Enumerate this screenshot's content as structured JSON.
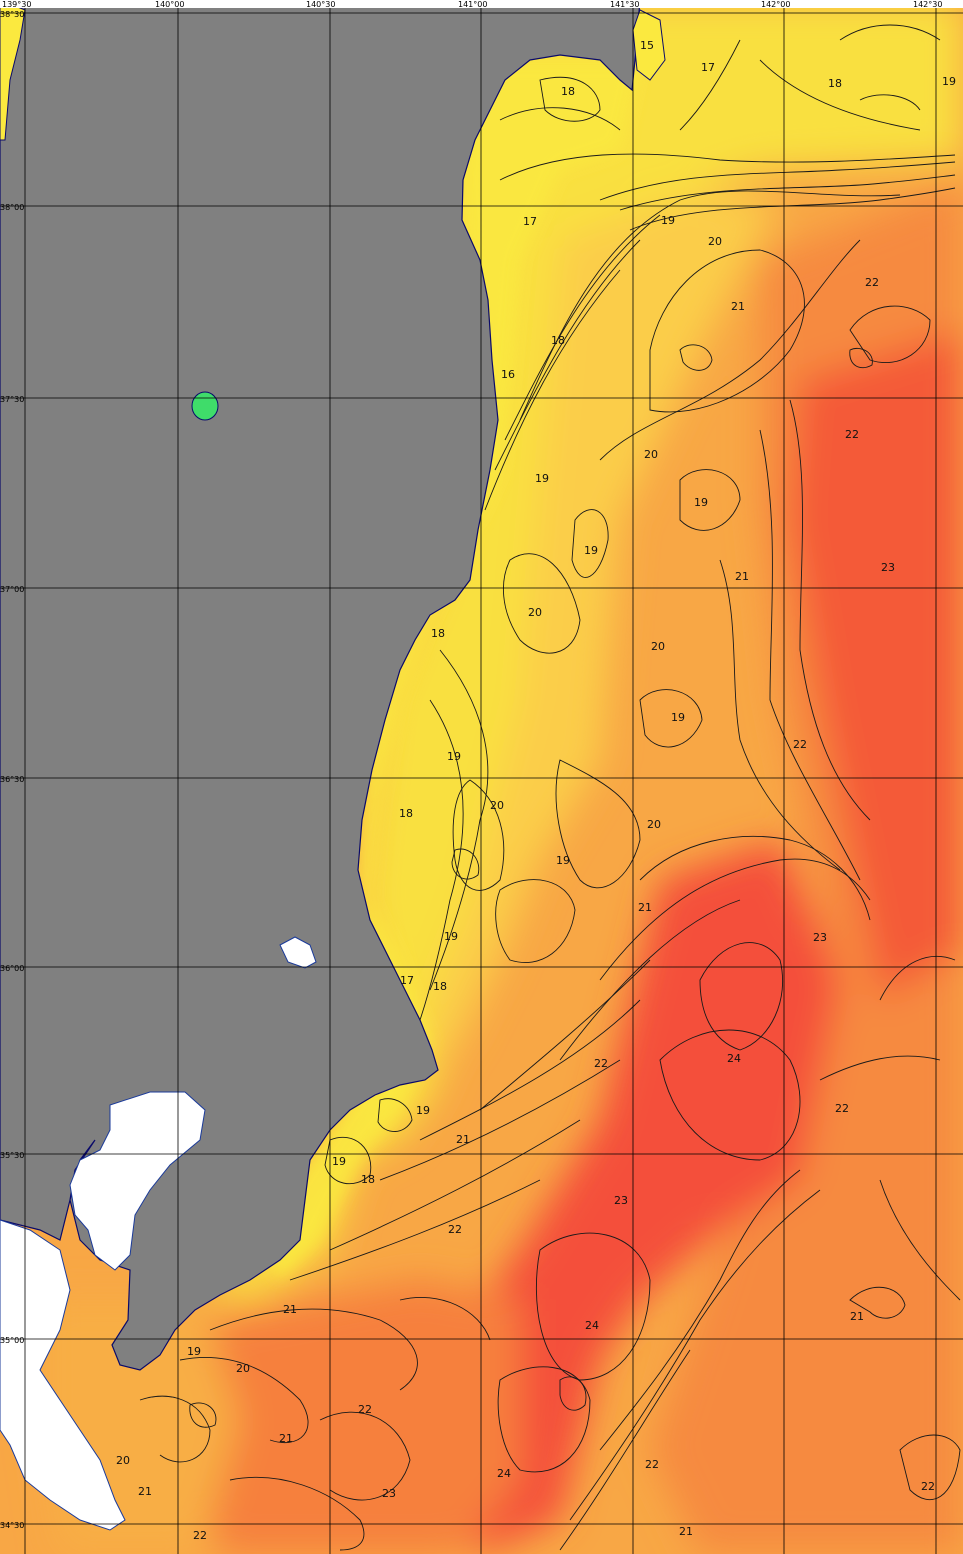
{
  "map": {
    "type": "sea-surface-temperature-contour-map",
    "colors": {
      "land": "#808080",
      "cold": "#fbec3e",
      "cool": "#fbd84a",
      "mid": "#f9b646",
      "warm": "#f79441",
      "hot": "#f5643d",
      "hottest": "#f44b34",
      "cloud": "#ffffff",
      "lake": "#3fdc6a",
      "contour": "#1a1a1a",
      "grid": "#000000"
    },
    "longitude_labels": [
      "139°30",
      "140°00",
      "140°30",
      "141°00",
      "141°30",
      "142°00",
      "142°30"
    ],
    "latitude_labels": [
      "38°30",
      "38°00",
      "37°30",
      "37°00",
      "36°30",
      "36°00",
      "35°30",
      "35°00",
      "34°30"
    ],
    "isotherm_labels": [
      "15",
      "17",
      "18",
      "18",
      "19",
      "17",
      "19",
      "20",
      "21",
      "22",
      "18",
      "16",
      "22",
      "19",
      "20",
      "19",
      "19",
      "21",
      "23",
      "18",
      "20",
      "20",
      "19",
      "22",
      "19",
      "20",
      "18",
      "20",
      "19",
      "21",
      "23",
      "19",
      "17",
      "18",
      "22",
      "24",
      "19",
      "22",
      "21",
      "19",
      "18",
      "23",
      "22",
      "21",
      "21",
      "24",
      "19",
      "20",
      "22",
      "21",
      "20",
      "24",
      "22",
      "23",
      "21",
      "22",
      "22"
    ]
  }
}
